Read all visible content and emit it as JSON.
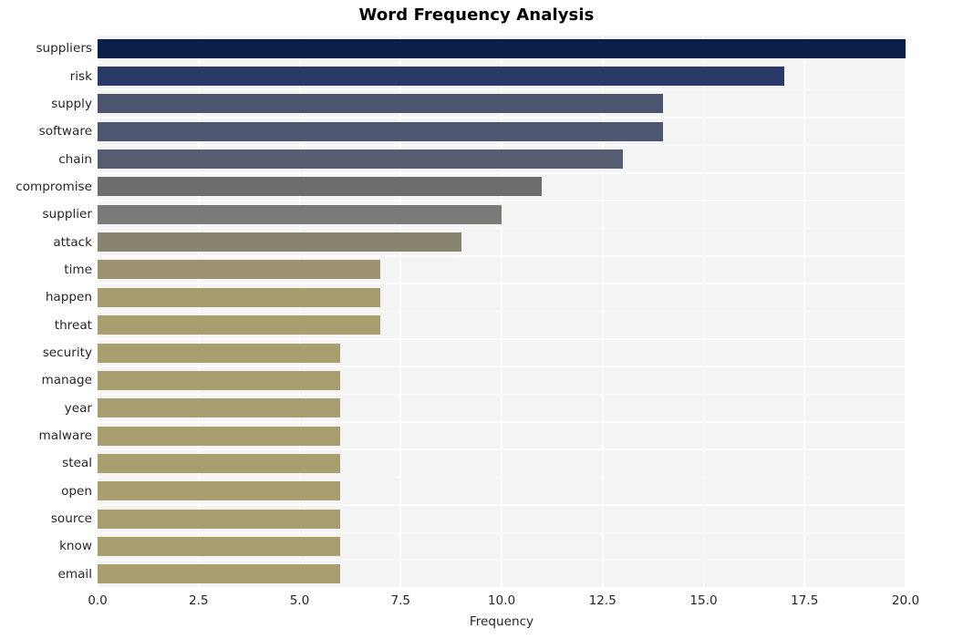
{
  "chart_data": {
    "type": "bar",
    "orientation": "horizontal",
    "title": "Word Frequency Analysis",
    "xlabel": "Frequency",
    "ylabel": "",
    "categories": [
      "suppliers",
      "risk",
      "supply",
      "software",
      "chain",
      "compromise",
      "supplier",
      "attack",
      "time",
      "happen",
      "threat",
      "security",
      "manage",
      "year",
      "malware",
      "steal",
      "open",
      "source",
      "know",
      "email"
    ],
    "values": [
      20,
      17,
      14,
      14,
      13,
      11,
      10,
      9,
      7,
      7,
      7,
      6,
      6,
      6,
      6,
      6,
      6,
      6,
      6,
      6
    ],
    "bar_colors": [
      "#0a2049",
      "#273a68",
      "#4d556e",
      "#4e5670",
      "#565c72",
      "#6d6d70",
      "#7b7a76",
      "#88846f",
      "#9b9370",
      "#a69c6f",
      "#a99e70",
      "#a99e70",
      "#a99e70",
      "#a99e70",
      "#a99e70",
      "#a99e70",
      "#a99e70",
      "#a99e70",
      "#a99e70",
      "#a99e70"
    ],
    "xlim": [
      0,
      20
    ],
    "xticks": [
      "0.0",
      "2.5",
      "5.0",
      "7.5",
      "10.0",
      "12.5",
      "15.0",
      "17.5",
      "20.0"
    ],
    "xtick_values": [
      0,
      2.5,
      5,
      7.5,
      10,
      12.5,
      15,
      17.5,
      20
    ],
    "grid": true,
    "grid_color": "#ffffff",
    "plot_background": "#f4f4f5",
    "figure_background": "#ffffff",
    "legend": null,
    "style": "whitegrid"
  }
}
